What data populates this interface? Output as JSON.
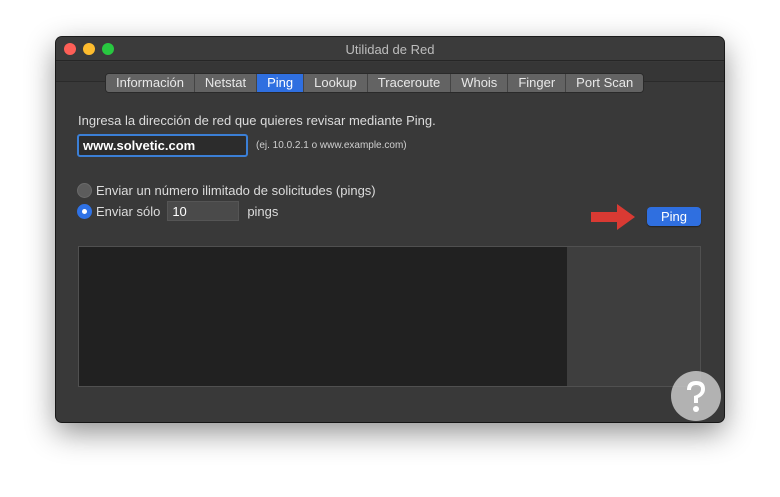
{
  "window": {
    "title": "Utilidad de Red"
  },
  "tabs": [
    {
      "label": "Información",
      "active": false
    },
    {
      "label": "Netstat",
      "active": false
    },
    {
      "label": "Ping",
      "active": true
    },
    {
      "label": "Lookup",
      "active": false
    },
    {
      "label": "Traceroute",
      "active": false
    },
    {
      "label": "Whois",
      "active": false
    },
    {
      "label": "Finger",
      "active": false
    },
    {
      "label": "Port Scan",
      "active": false
    }
  ],
  "ping": {
    "instructions": "Ingresa la dirección de red que quieres revisar mediante Ping.",
    "address_value": "www.solvetic.com",
    "address_example": "(ej. 10.0.2.1 o www.example.com)",
    "option_unlimited": "Enviar un número ilimitado de solicitudes (pings)",
    "option_limited": "Enviar sólo",
    "count_value": "10",
    "count_unit": "pings",
    "selected_option": "limited",
    "button_label": "Ping",
    "output_text": ""
  },
  "colors": {
    "accent": "#2f6fe0",
    "arrow": "#d93a33",
    "window_bg": "#393939"
  },
  "icons": [
    "close-light",
    "minimize-light",
    "zoom-light",
    "arrow-right-icon",
    "watermark-logo"
  ]
}
